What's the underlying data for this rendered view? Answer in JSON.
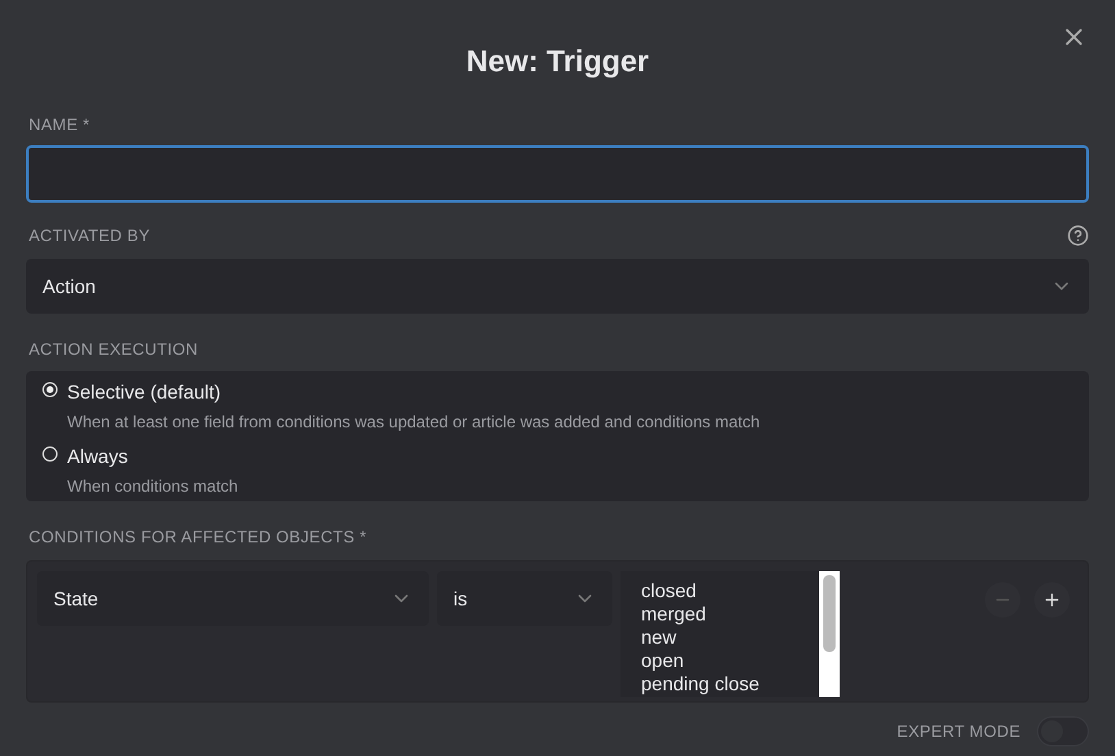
{
  "dialog": {
    "title": "New: Trigger"
  },
  "name_field": {
    "label": "NAME *",
    "focused": true
  },
  "activated_by": {
    "label": "ACTIVATED BY",
    "value": "Action"
  },
  "action_execution": {
    "label": "ACTION EXECUTION",
    "options": [
      {
        "label": "Selective (default)",
        "description": "When at least one field from conditions was updated or article was added and conditions match",
        "selected": true
      },
      {
        "label": "Always",
        "description": "When conditions match",
        "selected": false
      }
    ]
  },
  "conditions": {
    "label": "CONDITIONS FOR AFFECTED OBJECTS *",
    "attribute": "State",
    "operator": "is",
    "values": [
      {
        "label": "closed",
        "selected": false
      },
      {
        "label": "merged",
        "selected": false
      },
      {
        "label": "new",
        "selected": false
      },
      {
        "label": "open",
        "selected": false
      },
      {
        "label": "pending close",
        "selected": false
      }
    ]
  },
  "expert_mode": {
    "label": "EXPERT MODE",
    "on": false
  }
}
